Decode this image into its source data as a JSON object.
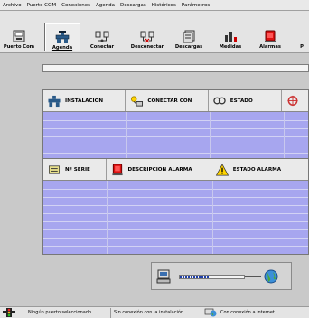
{
  "menu": [
    "Archivo",
    "Puerto COM",
    "Conexiones",
    "Agenda",
    "Descargas",
    "Históricos",
    "Parámetros"
  ],
  "toolbar": {
    "buttons": [
      {
        "label": "Puerto Com",
        "icon": "serial-port-icon"
      },
      {
        "label": "Agenda",
        "icon": "tap-icon",
        "active": true
      },
      {
        "label": "Conectar",
        "icon": "connect-icon"
      },
      {
        "label": "Desconectar",
        "icon": "disconnect-icon"
      },
      {
        "label": "Descargas",
        "icon": "download-icon"
      },
      {
        "label": "Medidas",
        "icon": "measures-icon"
      },
      {
        "label": "Alarmas",
        "icon": "alarm-icon"
      },
      {
        "label": "P",
        "icon": "partial-icon"
      }
    ]
  },
  "installation_field": {
    "value": ""
  },
  "install_table": {
    "columns": [
      {
        "label": "INSTALACION",
        "icon": "tap-icon"
      },
      {
        "label": "CONECTAR CON",
        "icon": "network-icon"
      },
      {
        "label": "ESTADO",
        "icon": "link-status-icon"
      },
      {
        "label": "",
        "icon": "settings-icon"
      }
    ]
  },
  "alarm_table": {
    "columns": [
      {
        "label": "Nº SERIE",
        "icon": "hand-list-icon"
      },
      {
        "label": "DESCRIPCION ALARMA",
        "icon": "alarm-icon"
      },
      {
        "label": "ESTADO ALARMA",
        "icon": "warning-icon"
      }
    ]
  },
  "progress": {
    "value": 0.45
  },
  "status": [
    {
      "text": "Ningún puerto seleccionado",
      "icon": "traffic-light-icon"
    },
    {
      "text": "Sin conexión con la instalación"
    },
    {
      "text": "Con conexión a internet",
      "icon": "internet-icon"
    }
  ],
  "colors": {
    "grid": "#a7a6ef",
    "progress": "#1f3fa8"
  }
}
